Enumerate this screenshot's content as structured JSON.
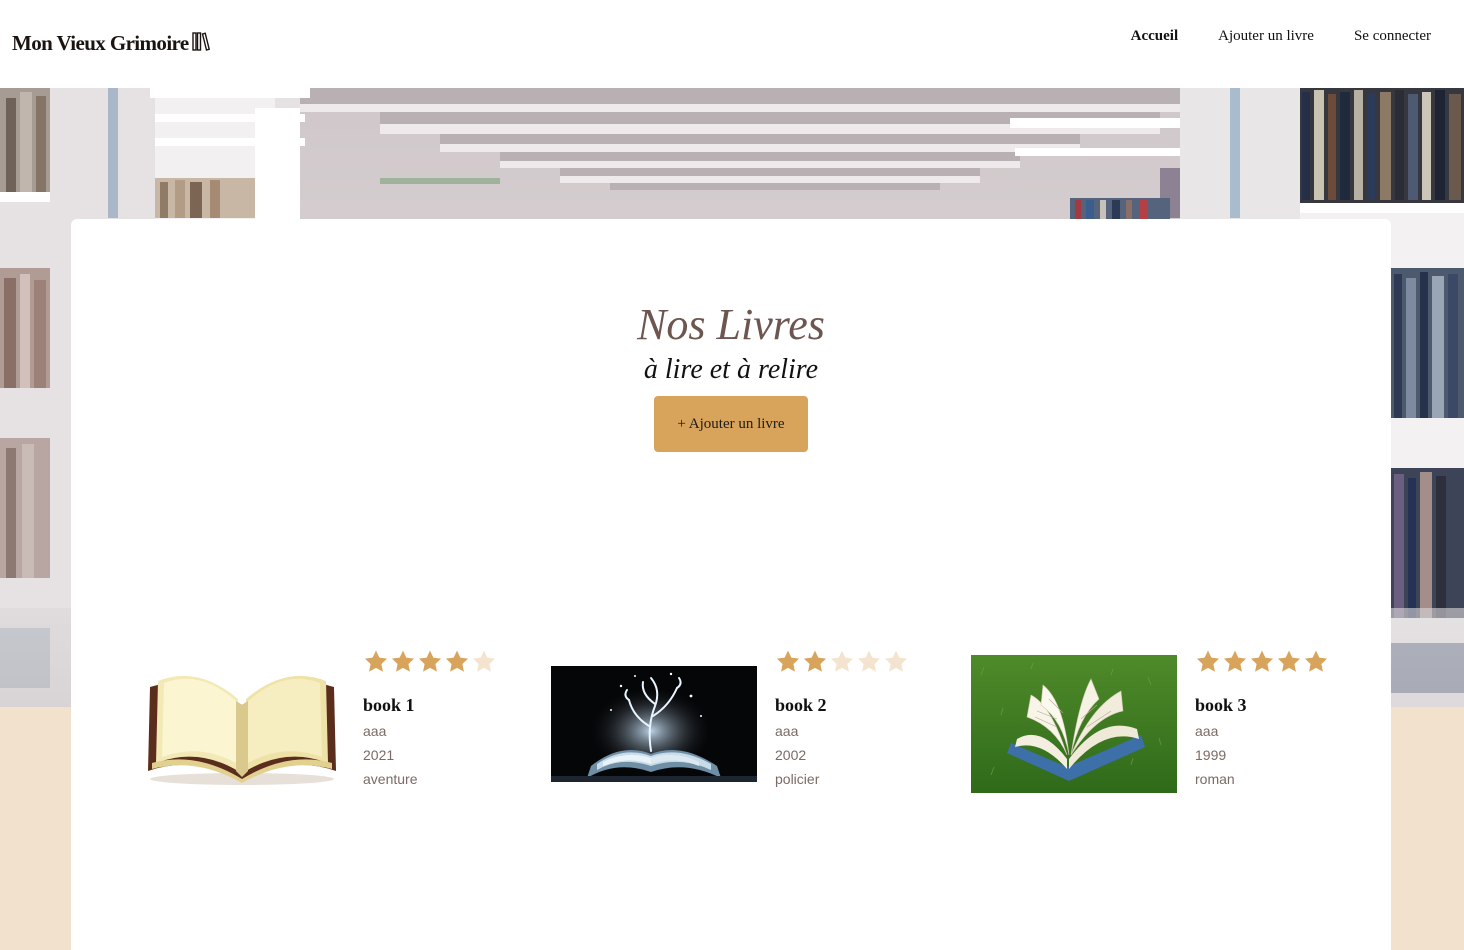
{
  "header": {
    "logo_text": "Mon Vieux Grimoire",
    "nav": [
      {
        "label": "Accueil",
        "active": true
      },
      {
        "label": "Ajouter un livre",
        "active": false
      },
      {
        "label": "Se connecter",
        "active": false
      }
    ]
  },
  "main": {
    "title": "Nos Livres",
    "subtitle": "à lire et à relire",
    "add_button_label": "+ Ajouter un livre"
  },
  "books": [
    {
      "title": "book 1",
      "author": "aaa",
      "year": "2021",
      "genre": "aventure",
      "rating": 4
    },
    {
      "title": "book 2",
      "author": "aaa",
      "year": "2002",
      "genre": "policier",
      "rating": 2
    },
    {
      "title": "book 3",
      "author": "aaa",
      "year": "1999",
      "genre": "roman",
      "rating": 5
    }
  ],
  "colors": {
    "accent": "#d8a35b",
    "star_filled": "#d8a35b",
    "star_empty": "#f4e4cf",
    "page_background": "#f2e2cd",
    "title_color": "#6d5550"
  },
  "icons": {
    "logo": "books-icon",
    "rating": "star-icon"
  }
}
